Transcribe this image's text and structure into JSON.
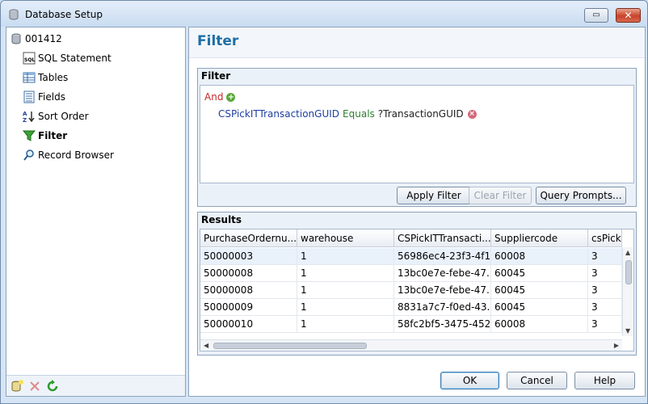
{
  "window": {
    "title": "Database Setup",
    "restore_glyph": "▭",
    "close_glyph": "✕"
  },
  "sidebar": {
    "root_label": "001412",
    "items": [
      {
        "label": "SQL Statement",
        "icon": "sql-icon"
      },
      {
        "label": "Tables",
        "icon": "table-icon"
      },
      {
        "label": "Fields",
        "icon": "fields-icon"
      },
      {
        "label": "Sort Order",
        "icon": "sort-az-icon"
      },
      {
        "label": "Filter",
        "icon": "filter-funnel-icon",
        "selected": true
      },
      {
        "label": "Record Browser",
        "icon": "magnifier-icon"
      }
    ],
    "toolbar": [
      "add-database-icon",
      "delete-icon",
      "refresh-icon"
    ]
  },
  "page": {
    "title": "Filter"
  },
  "filter": {
    "group_title": "Filter",
    "and_label": "And",
    "condition": {
      "field": "CSPickITTransactionGUID",
      "operator": "Equals",
      "value": "?TransactionGUID"
    },
    "apply_label": "Apply Filter",
    "clear_label": "Clear Filter",
    "prompts_label": "Query Prompts..."
  },
  "results": {
    "group_title": "Results",
    "columns": [
      "PurchaseOrdernu...",
      "warehouse",
      "CSPickITTransacti...",
      "Suppliercode",
      "csPick"
    ],
    "rows": [
      [
        "50000003",
        "1",
        "56986ec4-23f3-4f1...",
        "60008",
        "3"
      ],
      [
        "50000008",
        "1",
        "13bc0e7e-febe-47...",
        "60045",
        "3"
      ],
      [
        "50000008",
        "1",
        "13bc0e7e-febe-47...",
        "60045",
        "3"
      ],
      [
        "50000009",
        "1",
        "8831a7c7-f0ed-43...",
        "60045",
        "3"
      ],
      [
        "50000010",
        "1",
        "58fc2bf5-3475-452...",
        "60008",
        "3"
      ]
    ]
  },
  "footer": {
    "ok_label": "OK",
    "cancel_label": "Cancel",
    "help_label": "Help"
  },
  "colors": {
    "title_blue": "#1e6fa5",
    "and_red": "#c62828",
    "field_blue": "#1f3ea0",
    "operator_green": "#2e7d32"
  }
}
